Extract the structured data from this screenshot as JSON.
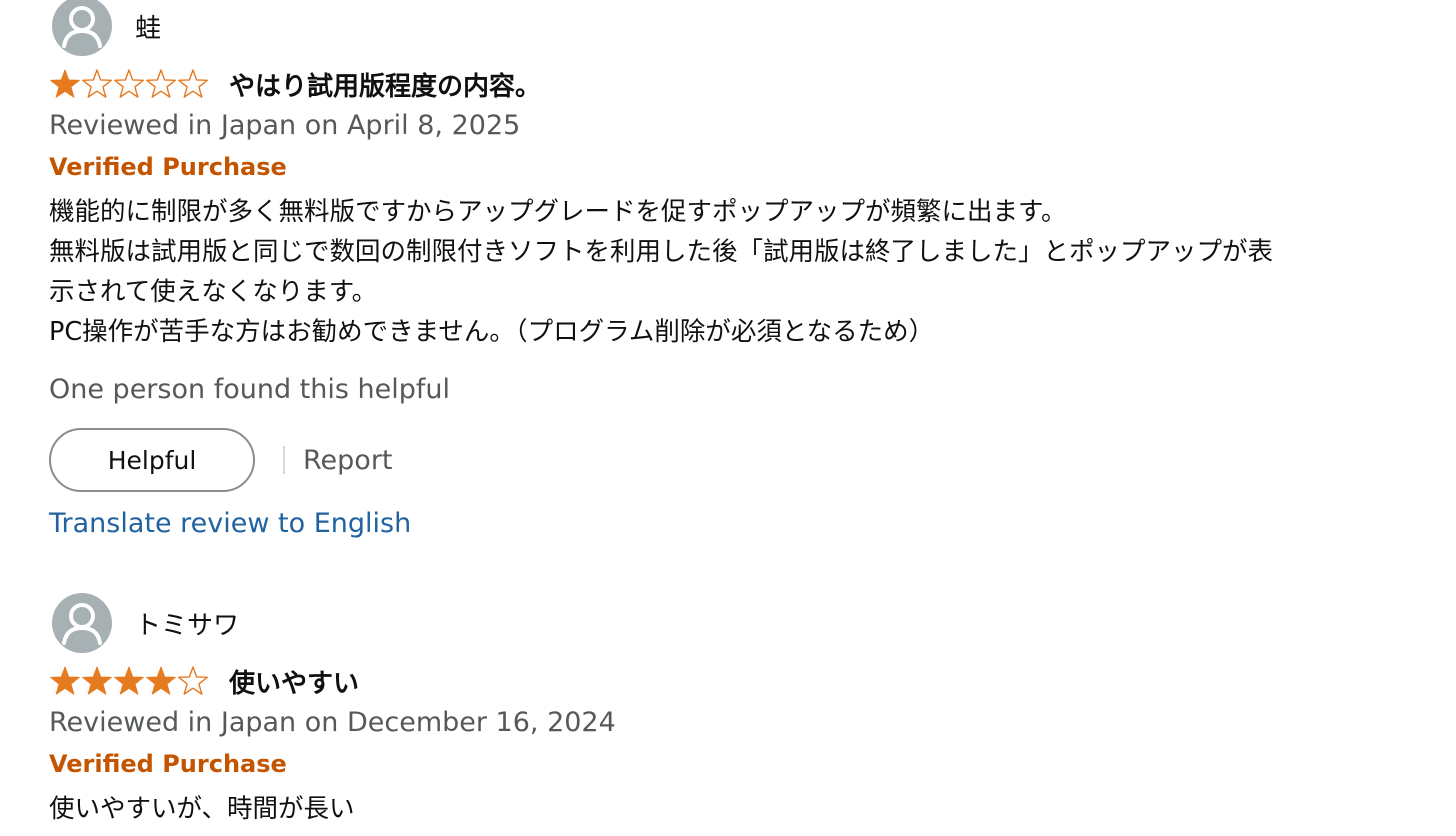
{
  "reviews": [
    {
      "profile_name": "蛙",
      "rating": 1,
      "title": "やはり試用版程度の内容。",
      "date": "Reviewed in Japan on April 8, 2025",
      "verified": "Verified Purchase",
      "body_lines": [
        "機能的に制限が多く無料版ですからアップグレードを促すポップアップが頻繁に出ます。",
        "無料版は試用版と同じで数回の制限付きソフトを利用した後「試用版は終了しました」とポップアップが表",
        "示されて使えなくなります。",
        "PC操作が苦手な方はお勧めできません。（プログラム削除が必須となるため）"
      ],
      "helpful_count": "One person found this helpful",
      "helpful_label": "Helpful",
      "report_label": "Report",
      "translate_label": "Translate review to English"
    },
    {
      "profile_name": "トミサワ",
      "rating": 4,
      "title": "使いやすい",
      "date": "Reviewed in Japan on December 16, 2024",
      "verified": "Verified Purchase",
      "body_lines": [
        "使いやすいが、時間が長い"
      ]
    }
  ],
  "colors": {
    "star_fill": "#e67a1f",
    "verified": "#c45500",
    "link": "#2162a1",
    "muted_text": "#565959",
    "avatar_bg": "#a7b1b3"
  },
  "icons": {
    "avatar": "default-profile-icon",
    "star_full": "star-filled-icon",
    "star_empty": "star-empty-icon"
  }
}
